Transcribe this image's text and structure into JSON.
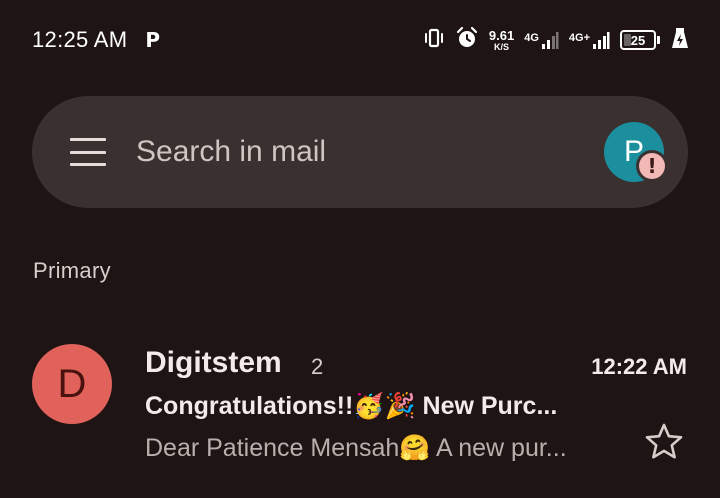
{
  "status_bar": {
    "time": "12:25 AM",
    "app_indicator": "P",
    "net_speed_value": "9.61",
    "net_speed_unit": "K/S",
    "sim1_label": "4G",
    "sim2_label": "4G+",
    "battery_level": "25",
    "icons": [
      "vibrate-icon",
      "alarm-icon",
      "signal-icon",
      "battery-icon",
      "charging-icon"
    ]
  },
  "search": {
    "placeholder": "Search in mail",
    "account_initial": "P",
    "alert_symbol": "!"
  },
  "section": {
    "label": "Primary"
  },
  "emails": [
    {
      "avatar_letter": "D",
      "sender": "Digitstem",
      "thread_count": "2",
      "time": "12:22 AM",
      "subject": "Congratulations!!🥳🎉 New Purc...",
      "snippet": "Dear Patience Mensah🤗 A new pur...",
      "starred": false
    }
  ],
  "colors": {
    "background": "#1e1414",
    "search_bar": "#3a302f",
    "account_avatar": "#1c8f9e",
    "sender_avatar": "#e0625a",
    "alert_badge": "#f2b8b5"
  }
}
